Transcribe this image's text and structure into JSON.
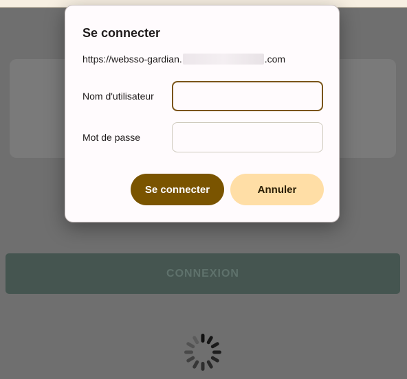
{
  "dialog": {
    "title": "Se connecter",
    "url_prefix": "https://websso-gardian.",
    "url_suffix": ".com",
    "username_label": "Nom d'utilisateur",
    "username_value": "",
    "password_label": "Mot de passe",
    "password_value": "",
    "confirm_label": "Se connecter",
    "cancel_label": "Annuler"
  },
  "page": {
    "connexion_label": "CONNEXION"
  },
  "colors": {
    "primary": "#7a5400",
    "secondary": "#ffdea6",
    "overlay": "#6f6f6f",
    "connexion_bg": "#455550"
  }
}
